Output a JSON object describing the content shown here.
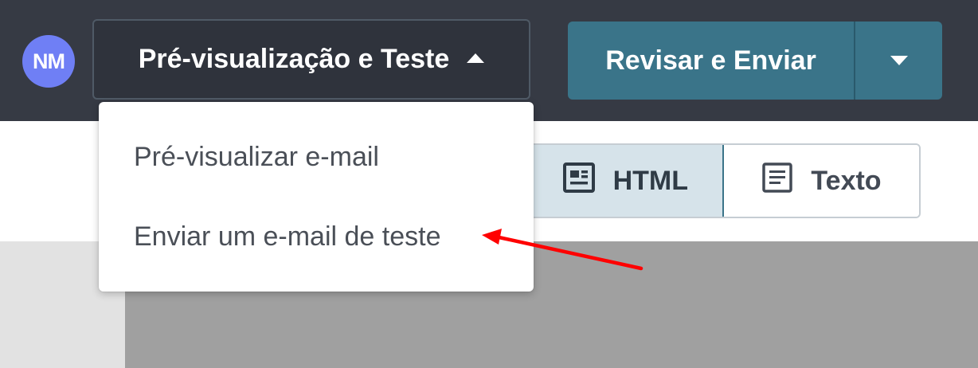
{
  "header": {
    "avatar_initials": "NM",
    "preview_button_label": "Pré-visualização e Teste",
    "send_button_label": "Revisar e Enviar"
  },
  "dropdown": {
    "items": [
      {
        "label": "Pré-visualizar e-mail"
      },
      {
        "label": "Enviar um e-mail de teste"
      }
    ]
  },
  "view_toggle": {
    "html_label": "HTML",
    "text_label": "Texto",
    "selected": "HTML"
  },
  "icons": {
    "preview_caret": "caret-up-icon",
    "send_caret": "caret-down-icon",
    "html_view": "html-view-icon",
    "text_view": "text-lines-icon",
    "annotation": "red-arrow-icon"
  },
  "colors": {
    "header_bg": "#363a44",
    "avatar_bg": "#6f7ff5",
    "primary_button": "#3a7489",
    "selected_toggle_bg": "#d6e3ea",
    "annotation_arrow": "#ff0000"
  }
}
